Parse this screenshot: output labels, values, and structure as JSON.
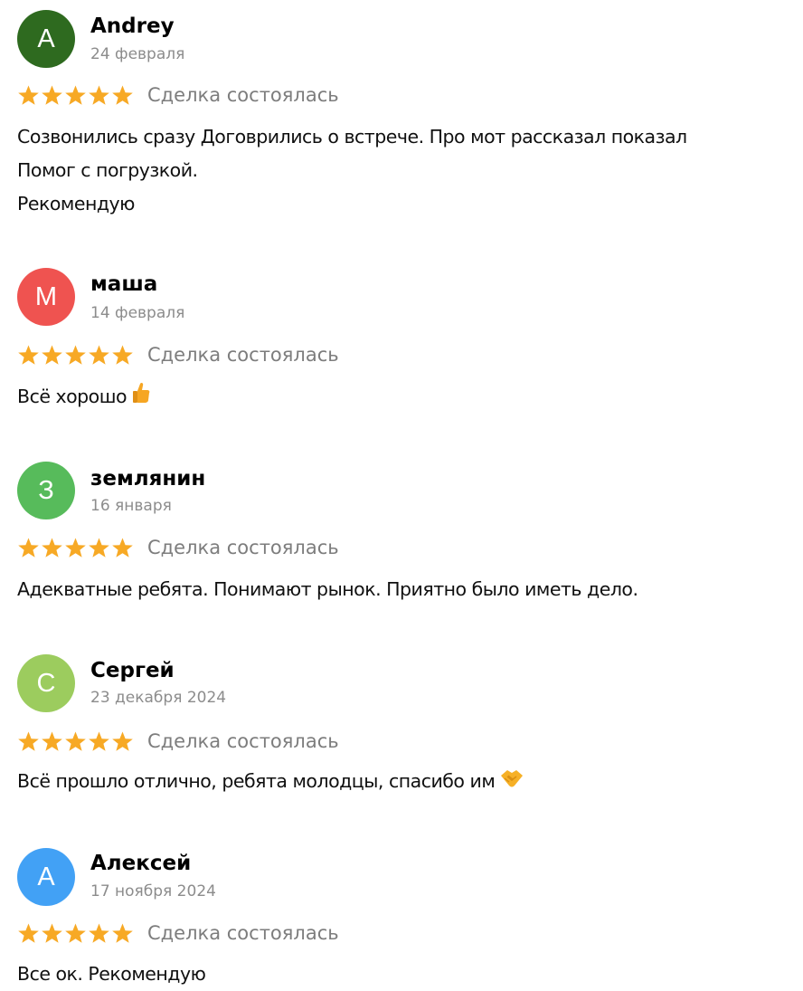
{
  "colors": {
    "star": "#f7a925",
    "status_text": "#7d7d7d",
    "date_text": "#8c8c8c"
  },
  "reviews": [
    {
      "avatar_letter": "A",
      "avatar_color": "#2e6a1f",
      "name": "Andrey",
      "date": "24 февраля",
      "rating": 5,
      "status": "Сделка состоялась",
      "text_lines": [
        "Созвонились сразу Договрились о встрече. Про мот рассказал показал",
        "Помог с погрузкой.",
        "Рекомендую"
      ]
    },
    {
      "avatar_letter": "М",
      "avatar_color": "#ef5350",
      "name": "маша",
      "date": "14 февраля",
      "rating": 5,
      "status": "Сделка состоялась",
      "text_lines": [
        "Всё хорошо"
      ],
      "emoji": "thumbs-up-emoji"
    },
    {
      "avatar_letter": "З",
      "avatar_color": "#57bb5b",
      "name": "землянин",
      "date": "16 января",
      "rating": 5,
      "status": "Сделка состоялась",
      "text_lines": [
        "Адекватные ребята. Понимают рынок. Приятно было иметь дело."
      ]
    },
    {
      "avatar_letter": "С",
      "avatar_color": "#9ccc5e",
      "name": "Сергей",
      "date": "23 декабря 2024",
      "rating": 5,
      "status": "Сделка состоялась",
      "text_lines": [
        "Всё прошло отлично, ребята молодцы, спасибо им"
      ],
      "emoji": "handshake-emoji"
    },
    {
      "avatar_letter": "А",
      "avatar_color": "#42a1f5",
      "name": "Алексей",
      "date": "17 ноября 2024",
      "rating": 5,
      "status": "Сделка состоялась",
      "text_lines": [
        "Все ок. Рекомендую"
      ]
    }
  ]
}
